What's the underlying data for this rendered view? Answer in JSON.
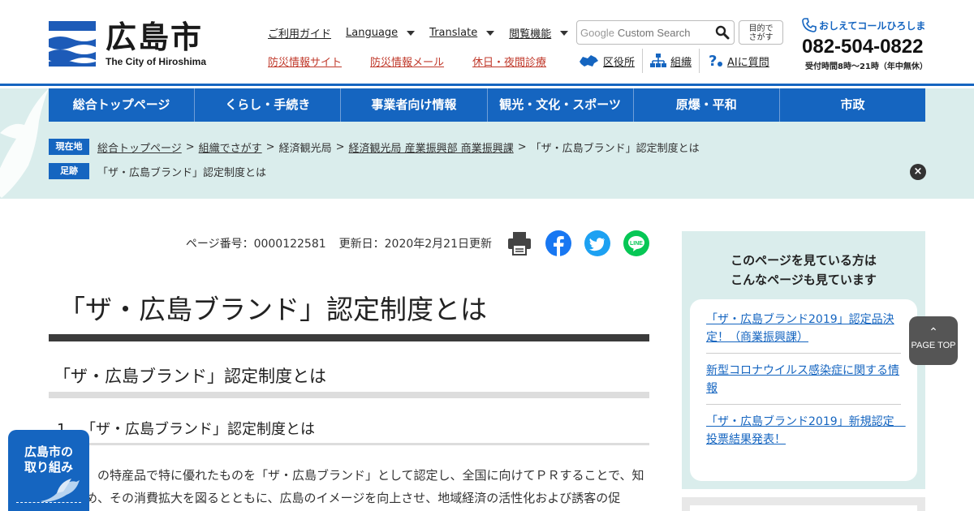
{
  "header": {
    "logo_jp": "広島市",
    "logo_en": "The City of Hiroshima",
    "nav_top": [
      "ご利用ガイド",
      "Language",
      "Translate",
      "閲覧機能"
    ],
    "nav_bottom": [
      "防災情報サイト",
      "防災情報メール",
      "休日・夜間診療"
    ],
    "search_brand": "Google",
    "search_placeholder": "Custom Search",
    "purpose_button": "目的で\nさがす",
    "tools": [
      "区役所",
      "組織",
      "AIに質問"
    ],
    "call_label": "おしえてコールひろしま",
    "call_number": "082-504-0822",
    "call_hours": "受付時間8時～21時（年中無休）"
  },
  "global_nav": [
    "総合トップページ",
    "くらし・手続き",
    "事業者向け情報",
    "観光・文化・スポーツ",
    "原爆・平和",
    "市政"
  ],
  "breadcrumb": {
    "tag_current": "現在地",
    "links": [
      "総合トップページ",
      "組織でさがす"
    ],
    "plain": "経済観光局",
    "link3": "経済観光局 産業振興部 商業振興課",
    "current": "「ザ・広島ブランド」認定制度とは",
    "tag_history": "足跡",
    "history_item": "「ザ・広島ブランド」認定制度とは"
  },
  "meta": {
    "page_number": "ページ番号：0000122581",
    "updated": "更新日：2020年2月21日更新"
  },
  "content": {
    "title": "「ザ・広島ブランド」認定制度とは",
    "heading2": "「ザ・広島ブランド」認定制度とは",
    "section_number": "1",
    "heading3": "「ザ・広島ブランド」認定制度とは",
    "paragraph": "の特産品で特に優れたものを「ザ・広島ブランド」として認定し、全国に向けてＰＲすることで、知名り高め、その消費拡大を図るとともに、広島のイメージを向上させ、地域経済の活性化および誘客の促"
  },
  "sidebar": {
    "title_line1": "このページを見ている方は",
    "title_line2": "こんなページも見ています",
    "items": [
      "「ザ・広島ブランド2019」認定品決定！（商業振興課）",
      "新型コロナウイルス感染症に関する情報",
      "「ザ・広島ブランド2019」新規認定　投票結果発表！"
    ]
  },
  "page_top": "PAGE TOP",
  "torikumi": "広島市の取り組み",
  "colors": {
    "brand_blue": "#1565c0",
    "band_bg": "#daedec",
    "alert_red": "#c0392b"
  }
}
